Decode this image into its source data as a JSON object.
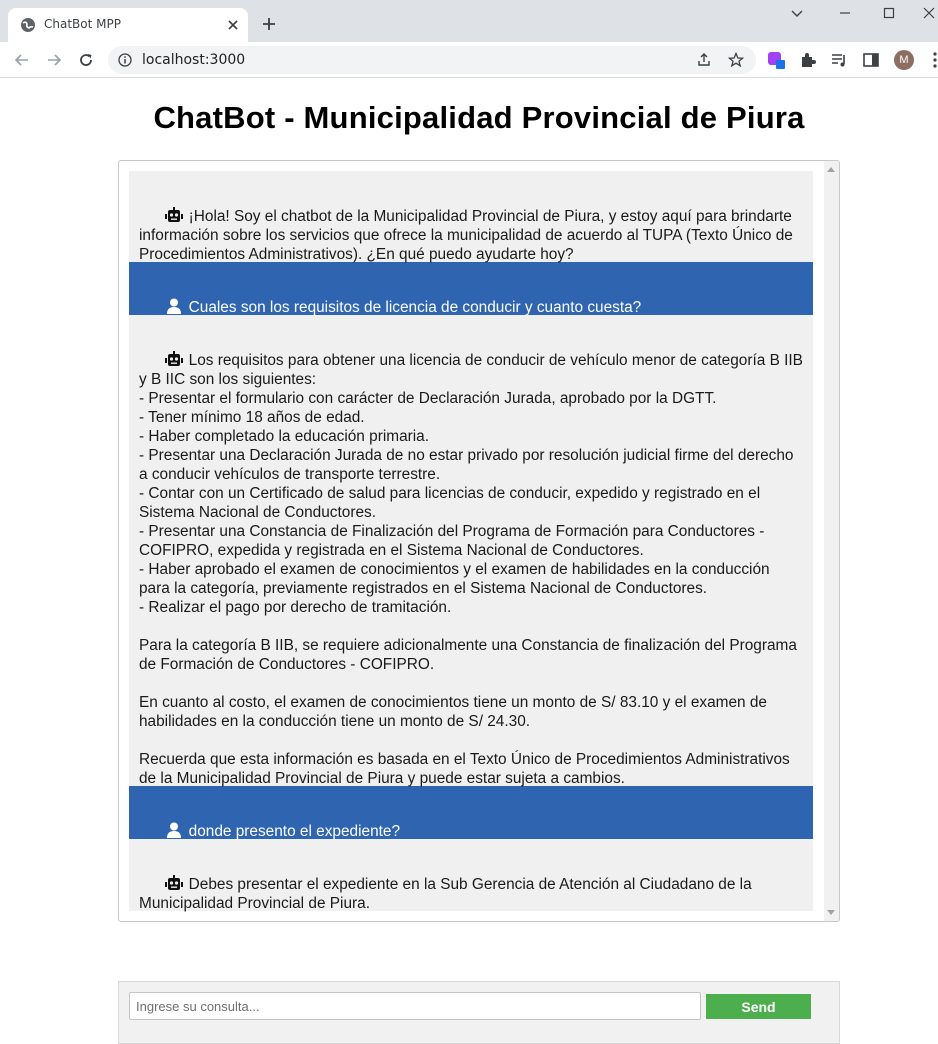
{
  "browser": {
    "tab_title": "ChatBot MPP",
    "url": "localhost:3000",
    "avatar_letter": "M",
    "icons": [
      "globe-icon",
      "close-icon",
      "plus-icon",
      "chevron-down-icon",
      "minimize-icon",
      "maximize-icon",
      "close-window-icon",
      "back-icon",
      "forward-icon",
      "reload-icon",
      "info-icon",
      "share-icon",
      "star-icon",
      "extension-icon",
      "puzzle-icon",
      "reading-list-icon",
      "side-panel-icon",
      "more-icon"
    ]
  },
  "page": {
    "title": "ChatBot - Municipalidad Provincial de Piura"
  },
  "chat": {
    "messages": [
      {
        "role": "bot",
        "icon": "robot-icon",
        "text": "¡Hola! Soy el chatbot de la Municipalidad Provincial de Piura, y estoy aquí para brindarte información sobre los servicios que ofrece la municipalidad de acuerdo al TUPA (Texto Único de Procedimientos Administrativos). ¿En qué puedo ayudarte hoy?"
      },
      {
        "role": "user",
        "icon": "user-icon",
        "text": "Cuales son los requisitos de licencia de conducir y cuanto cuesta?"
      },
      {
        "role": "bot",
        "icon": "robot-icon",
        "text": "Los requisitos para obtener una licencia de conducir de vehículo menor de categoría B IIB y B IIC son los siguientes:\n- Presentar el formulario con carácter de Declaración Jurada, aprobado por la DGTT.\n- Tener mínimo 18 años de edad.\n- Haber completado la educación primaria.\n- Presentar una Declaración Jurada de no estar privado por resolución judicial firme del derecho a conducir vehículos de transporte terrestre.\n- Contar con un Certificado de salud para licencias de conducir, expedido y registrado en el Sistema Nacional de Conductores.\n- Presentar una Constancia de Finalización del Programa de Formación para Conductores - COFIPRO, expedida y registrada en el Sistema Nacional de Conductores.\n- Haber aprobado el examen de conocimientos y el examen de habilidades en la conducción para la categoría, previamente registrados en el Sistema Nacional de Conductores.\n- Realizar el pago por derecho de tramitación.\n\nPara la categoría B IIB, se requiere adicionalmente una Constancia de finalización del Programa de Formación de Conductores - COFIPRO.\n\nEn cuanto al costo, el examen de conocimientos tiene un monto de S/ 83.10 y el examen de habilidades en la conducción tiene un monto de S/ 24.30.\n\nRecuerda que esta información es basada en el Texto Único de Procedimientos Administrativos de la Municipalidad Provincial de Piura y puede estar sujeta a cambios."
      },
      {
        "role": "user",
        "icon": "user-icon",
        "text": "donde presento el expediente?"
      },
      {
        "role": "bot",
        "icon": "robot-icon",
        "text": "Debes presentar el expediente en la Sub Gerencia de Atención al Ciudadano de la Municipalidad Provincial de Piura."
      }
    ]
  },
  "input": {
    "value": "",
    "placeholder": "Ingrese su consulta...",
    "send_label": "Send"
  },
  "colors": {
    "user_bubble": "#2f65b0",
    "bot_bubble": "#f0f0f0",
    "send_button": "#4cae4c"
  }
}
